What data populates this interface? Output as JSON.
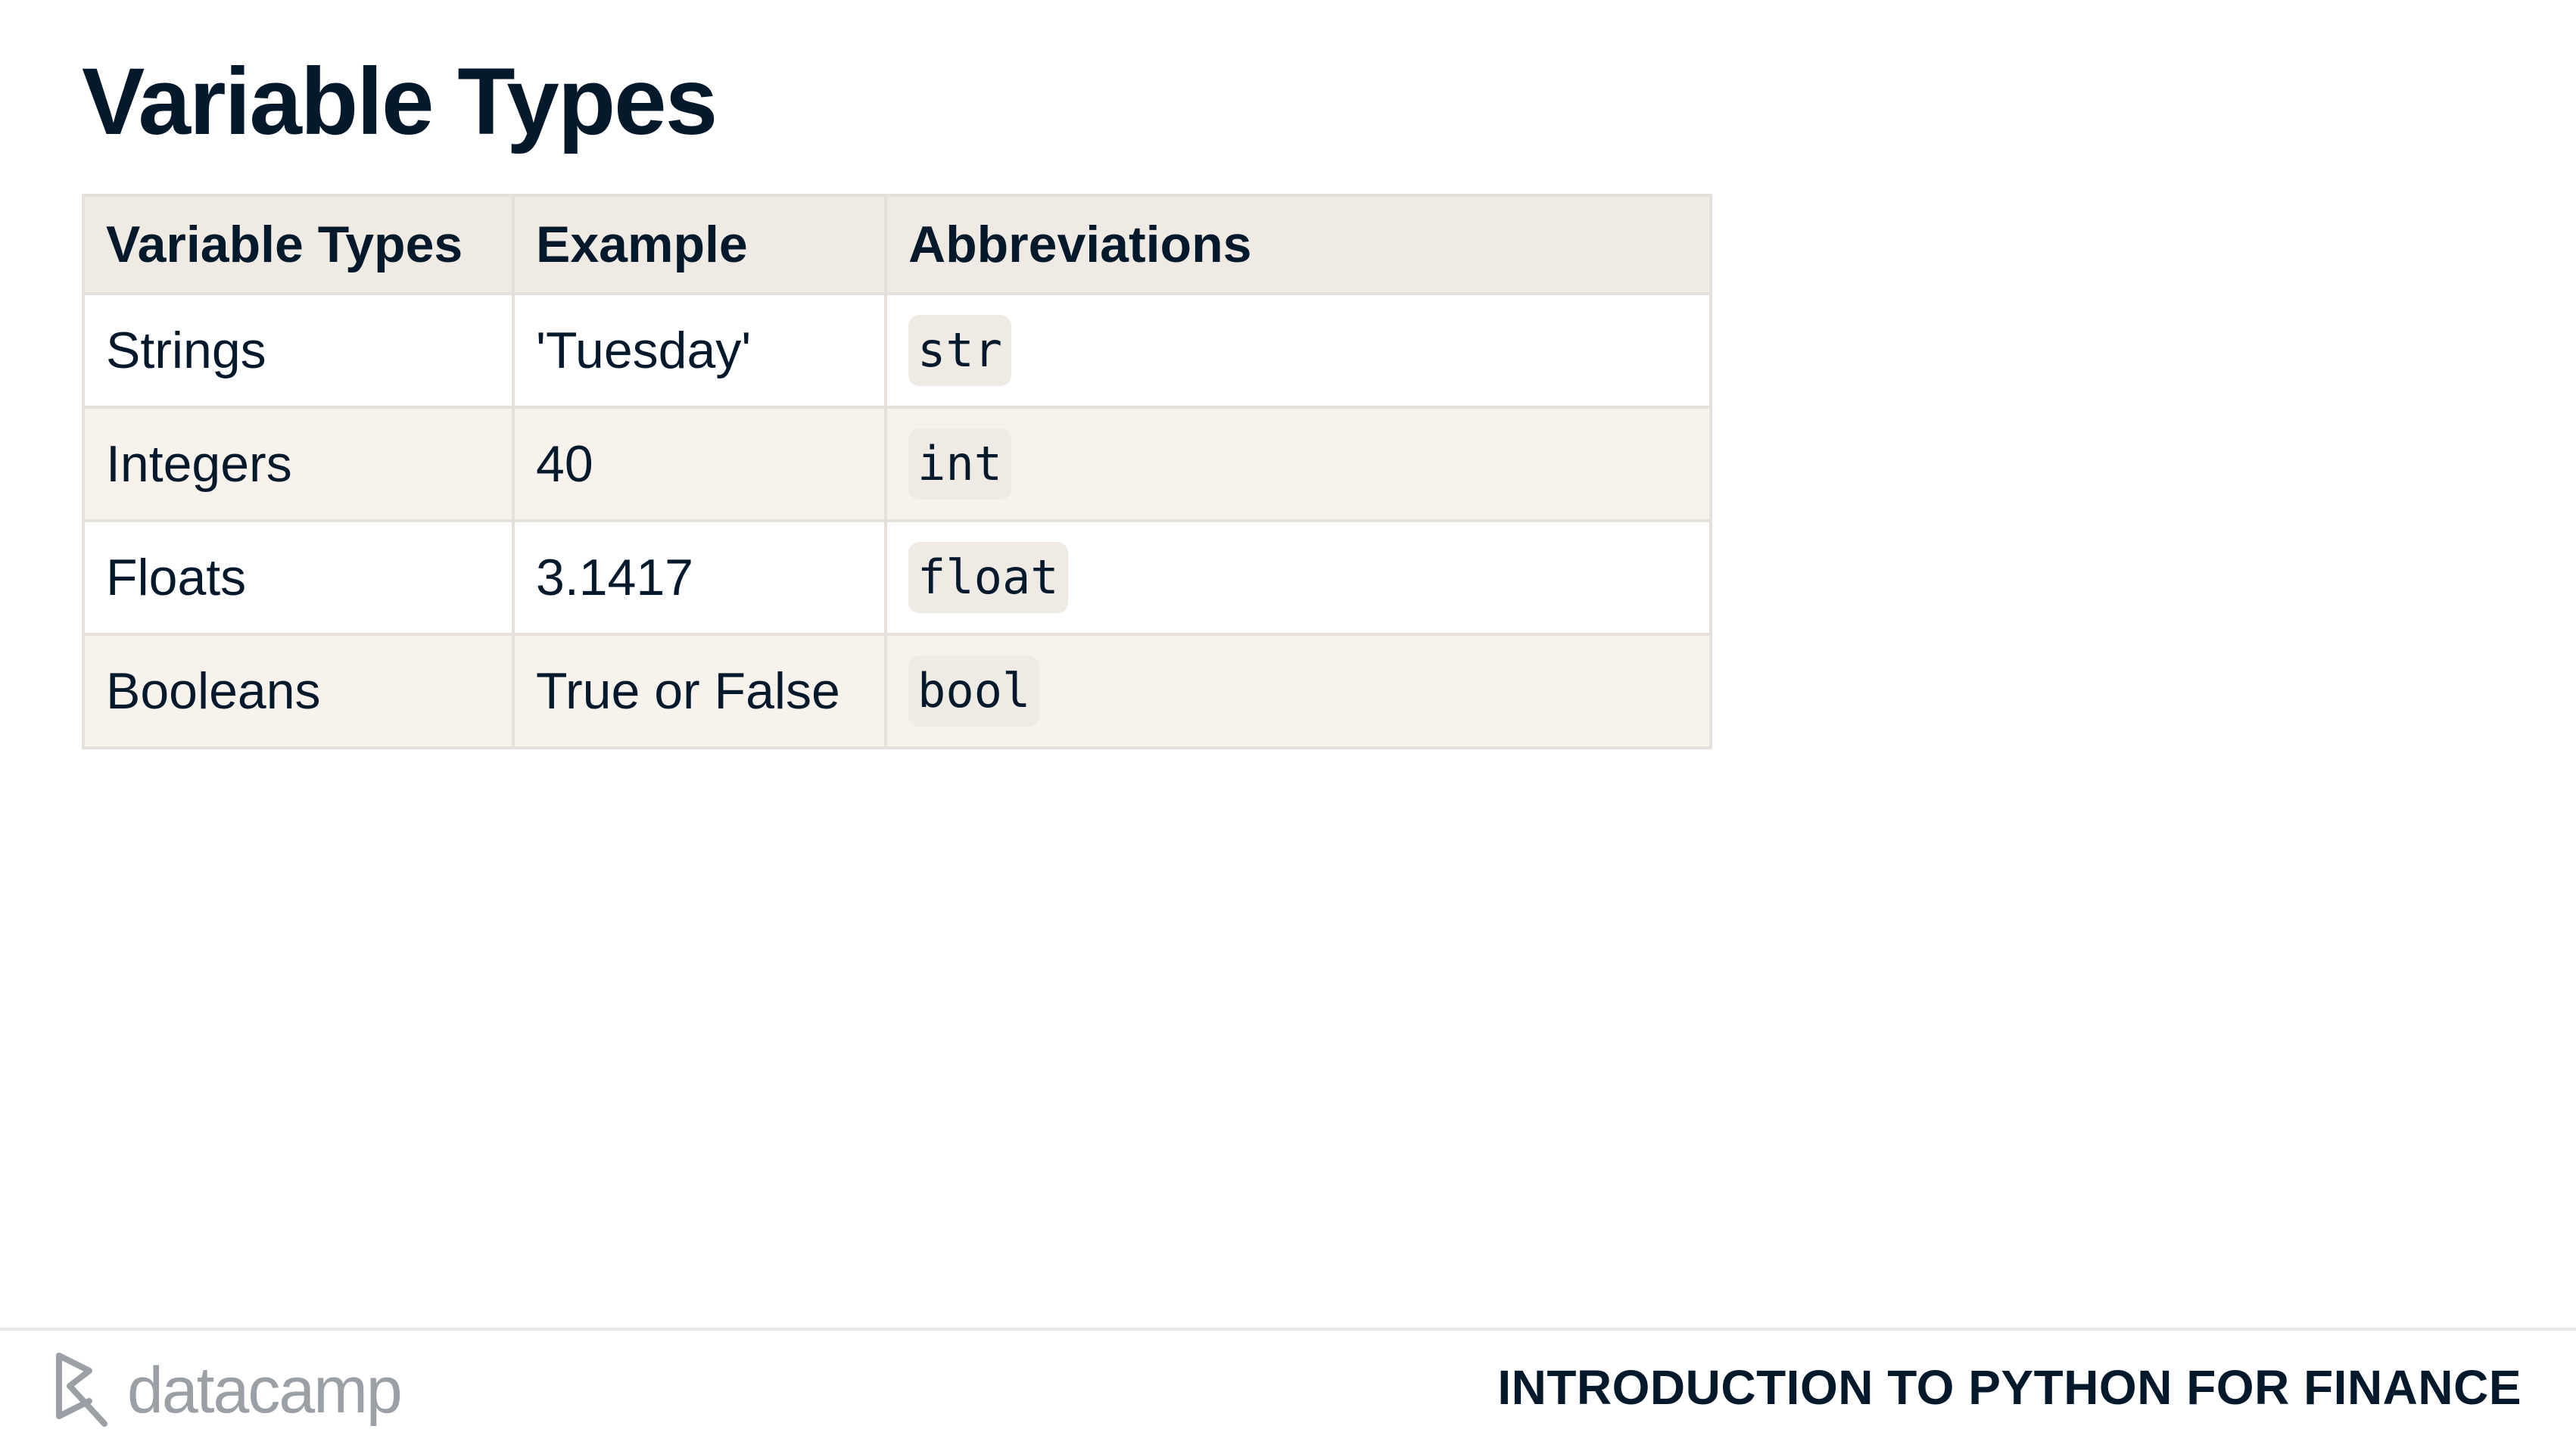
{
  "slide": {
    "title": "Variable Types"
  },
  "table": {
    "headers": [
      "Variable Types",
      "Example",
      "Abbreviations"
    ],
    "rows": [
      {
        "type": "Strings",
        "example": "'Tuesday'",
        "abbreviation": "str"
      },
      {
        "type": "Integers",
        "example": "40",
        "abbreviation": "int"
      },
      {
        "type": "Floats",
        "example": "3.1417",
        "abbreviation": "float"
      },
      {
        "type": "Booleans",
        "example": "True or False",
        "abbreviation": "bool"
      }
    ]
  },
  "footer": {
    "brand": "datacamp",
    "brand_icon": "datacamp-logo-icon",
    "course_title": "INTRODUCTION TO PYTHON FOR FINANCE"
  },
  "colors": {
    "text_dark": "#05192d",
    "header_bg": "#efebe4",
    "alt_row_bg": "#f7f3ec",
    "border": "#e5e1da",
    "brand_gray": "#9aa0a6"
  }
}
